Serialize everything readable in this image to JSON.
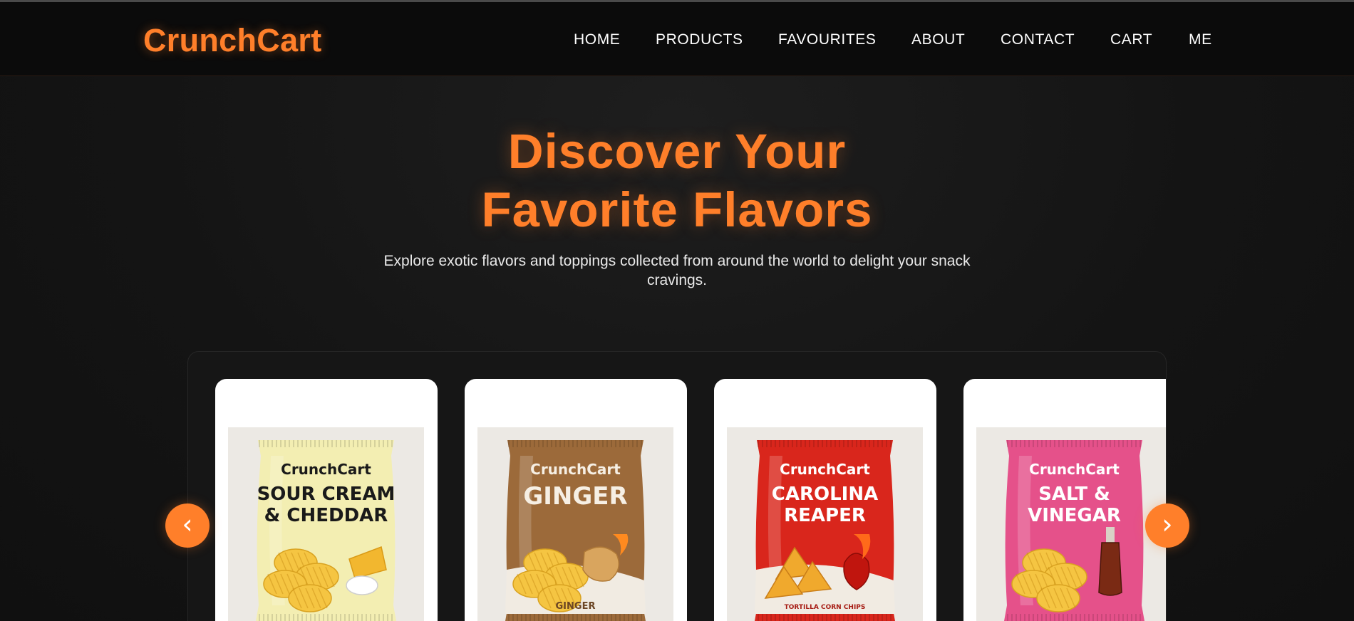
{
  "brand": {
    "name": "CrunchCart",
    "accent_color": "#ff7f2a"
  },
  "nav": {
    "items": [
      {
        "label": "HOME"
      },
      {
        "label": "PRODUCTS"
      },
      {
        "label": "FAVOURITES"
      },
      {
        "label": "ABOUT"
      },
      {
        "label": "CONTACT"
      },
      {
        "label": "CART"
      },
      {
        "label": "ME"
      }
    ]
  },
  "hero": {
    "title_line1": "Discover Your",
    "title_line2": "Favorite Flavors",
    "subtitle": "Explore exotic flavors and toppings collected from around the world to delight your snack cravings."
  },
  "carousel": {
    "prev_icon": "chevron-left-icon",
    "next_icon": "chevron-right-icon",
    "prev_glyph": "‹",
    "next_glyph": "›",
    "products": [
      {
        "brand": "CrunchCart",
        "flavor_line1": "SOUR CREAM",
        "flavor_line2": "& CHEDDAR",
        "tagline": "",
        "bag_color": "#f3eeb2",
        "text_color": "#1a1a1a",
        "brand_color": "#1a1a1a"
      },
      {
        "brand": "CrunchCart",
        "flavor_line1": "GINGER",
        "flavor_line2": "",
        "tagline": "GINGER",
        "bag_color": "#9c6a3a",
        "text_color": "#f6efe4",
        "brand_color": "#f6efe4"
      },
      {
        "brand": "CrunchCart",
        "flavor_line1": "CAROLINA",
        "flavor_line2": "REAPER",
        "tagline": "TORTILLA CORN CHIPS",
        "bag_color": "#d9261c",
        "text_color": "#ffffff",
        "brand_color": "#ffffff"
      },
      {
        "brand": "CrunchCart",
        "flavor_line1": "SALT &",
        "flavor_line2": "VINEGAR",
        "tagline": "",
        "bag_color": "#e5518a",
        "text_color": "#ffffff",
        "brand_color": "#ffffff"
      }
    ]
  }
}
